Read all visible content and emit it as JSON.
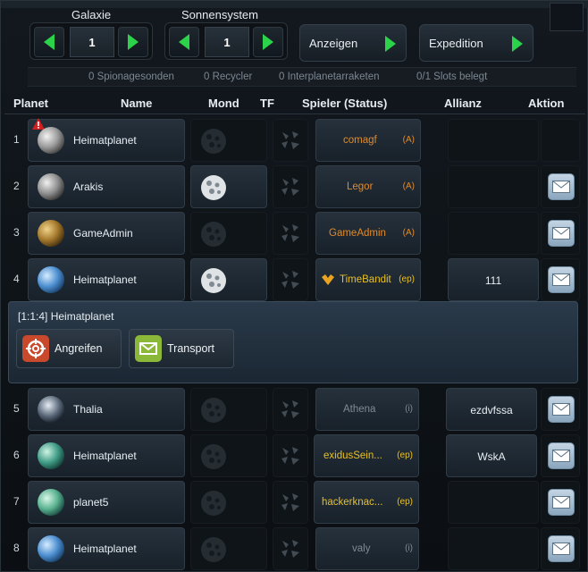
{
  "header": {
    "galaxy_label": "Galaxie",
    "galaxy_value": "1",
    "system_label": "Sonnensystem",
    "system_value": "1",
    "show_label": "Anzeigen",
    "expedition_label": "Expedition"
  },
  "info": {
    "probes": "0 Spionagesonden",
    "recyclers": "0 Recycler",
    "missiles": "0 Interplanetarraketen",
    "slots": "0/1 Slots belegt"
  },
  "columns": {
    "planet": "Planet",
    "name": "Name",
    "moon": "Mond",
    "tf": "TF",
    "player": "Spieler (Status)",
    "alliance": "Allianz",
    "action": "Aktion"
  },
  "rows": [
    {
      "pos": "1",
      "name": "Heimatplanet",
      "player": "comagf",
      "status": "(A)",
      "alliance": ""
    },
    {
      "pos": "2",
      "name": "Arakis",
      "player": "Legor",
      "status": "(A)",
      "alliance": ""
    },
    {
      "pos": "3",
      "name": "GameAdmin",
      "player": "GameAdmin",
      "status": "(A)",
      "alliance": ""
    },
    {
      "pos": "4",
      "name": "Heimatplanet",
      "player": "TimeBandit",
      "status": "(ep)",
      "alliance": "111"
    },
    {
      "pos": "5",
      "name": "Thalia",
      "player": "Athena",
      "status": "(i)",
      "alliance": "ezdvfssa"
    },
    {
      "pos": "6",
      "name": "Heimatplanet",
      "player": "exidusSein...",
      "status": "(ep)",
      "alliance": "WskA"
    },
    {
      "pos": "7",
      "name": "planet5",
      "player": "hackerknac...",
      "status": "(ep)",
      "alliance": ""
    },
    {
      "pos": "8",
      "name": "Heimatplanet",
      "player": "valy",
      "status": "(i)",
      "alliance": ""
    }
  ],
  "panel": {
    "title": "[1:1:4] Heimatplanet",
    "attack_label": "Angreifen",
    "transport_label": "Transport"
  },
  "colors": {
    "arrow_green": "#2bd24a",
    "player_active": "#e08a2a",
    "player_ep": "#e9c021",
    "player_inactive": "#7f8a94",
    "warning_red": "#d21f1f"
  },
  "icons": {
    "prev": "arrow-left-icon",
    "next": "arrow-right-icon",
    "mail": "envelope-icon",
    "debris": "debris-field-icon",
    "moon": "moon-icon",
    "warning": "warning-icon",
    "attack": "crosshair-icon",
    "transport": "transport-icon"
  }
}
